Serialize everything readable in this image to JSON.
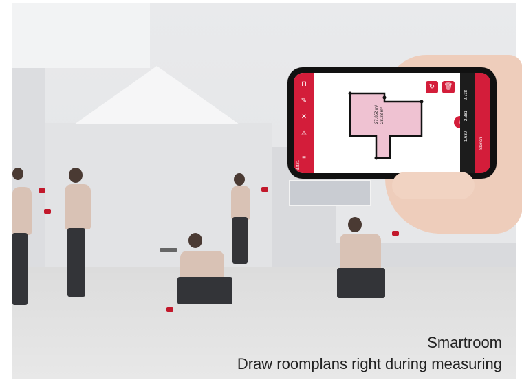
{
  "caption": {
    "line1": "Smartroom",
    "line2": "Draw roomplans right during measuring"
  },
  "phone_app": {
    "accent_color": "#d31d3a",
    "room_fill_color": "#efc2d2",
    "area_label": "27.852 m²",
    "volume_label": "28.23 m³",
    "left_toolbar_icons": [
      "bracket-icon",
      "pen-icon",
      "delete-icon",
      "warning-icon",
      "list-icon"
    ],
    "top_right_icons": [
      "redo-icon",
      "trash-icon"
    ],
    "right_panel_values": [
      "2.738",
      "2.381",
      "1.630"
    ],
    "bottom_value": "3.821",
    "sketch_label": "Sketch"
  }
}
